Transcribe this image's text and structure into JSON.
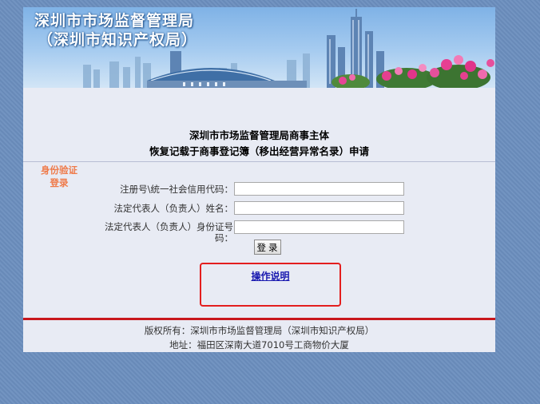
{
  "banner": {
    "title_line1": "深圳市市场监督管理局",
    "title_line2": "（深圳市知识产权局）"
  },
  "main": {
    "title_line1": "深圳市市场监督管理局商事主体",
    "title_line2": "恢复记载于商事登记簿（移出经营异常名录）申请"
  },
  "sidebar": {
    "label_line1": "身份验证",
    "label_line2": "登录"
  },
  "form": {
    "reg_no_label": "注册号\\统一社会信用代码：",
    "reg_no_value": "",
    "rep_name_label": "法定代表人（负责人）姓名：",
    "rep_name_value": "",
    "rep_id_label_line1": "法定代表人（负责人）身份证号",
    "rep_id_label_line2": "码：",
    "rep_id_value": "",
    "login_button": "登录"
  },
  "help": {
    "link_text": "操作说明"
  },
  "footer": {
    "copyright": "版权所有：深圳市市场监督管理局（深圳市知识产权局）",
    "address": "地址：福田区深南大道7010号工商物价大厦"
  },
  "colors": {
    "page_bg": "#6b8ebe",
    "panel_bg": "#e8ebf4",
    "side_label": "#ef7a49",
    "footer_rule": "#c8171c",
    "help_box_border": "#e31e1e",
    "link": "#1a1ab0"
  }
}
